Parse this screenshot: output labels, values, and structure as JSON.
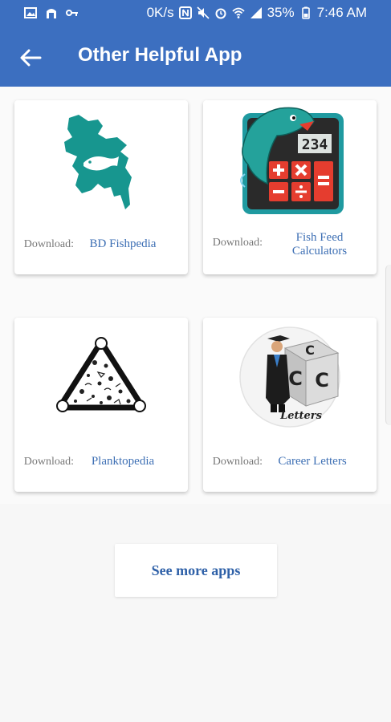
{
  "status_bar": {
    "speed": "0K/s",
    "battery": "35%",
    "time": "7:46 AM"
  },
  "header": {
    "title": "Other Helpful App",
    "back_icon": "back-arrow-icon"
  },
  "apps": [
    {
      "download_label": "Download:",
      "name": "BD Fishpedia",
      "icon": "bangladesh-map-fish-icon"
    },
    {
      "download_label": "Download:",
      "name": "Fish Feed Calculators",
      "icon": "fish-calculator-icon"
    },
    {
      "download_label": "Download:",
      "name": "Planktopedia",
      "icon": "plankton-triangle-icon"
    },
    {
      "download_label": "Download:",
      "name": "Career Letters",
      "icon": "career-letters-icon"
    }
  ],
  "see_more": "See more apps",
  "colors": {
    "appbar": "#3c6fc0",
    "link": "#3d6fb4",
    "teal": "#17968f"
  }
}
